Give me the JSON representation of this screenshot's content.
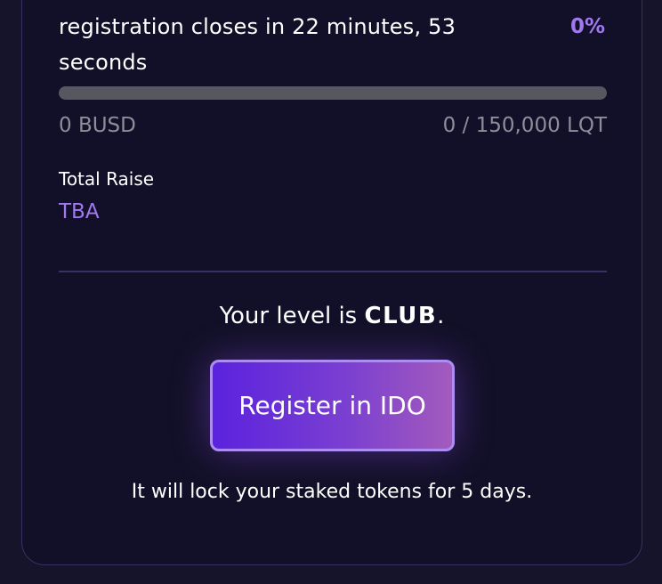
{
  "sale": {
    "status_text": "registration closes in 22 minutes, 53 seconds",
    "percent_label": "0%",
    "progress_fraction": 0,
    "raised": "0 BUSD",
    "cap": "0 / 150,000 LQT",
    "total_raise_label": "Total Raise",
    "total_raise_value": "TBA"
  },
  "level": {
    "prefix": "Your level is ",
    "name": "CLUB",
    "suffix": "."
  },
  "register": {
    "button_label": "Register in IDO",
    "note": "It will lock your staked tokens for 5 days."
  },
  "colors": {
    "background": "#16142a",
    "card": "#121028",
    "accent": "#a079ef",
    "muted_text": "#8e8e99",
    "border": "#3b3063",
    "button_gradient_start": "#5b22de",
    "button_gradient_end": "#a35bbc"
  }
}
